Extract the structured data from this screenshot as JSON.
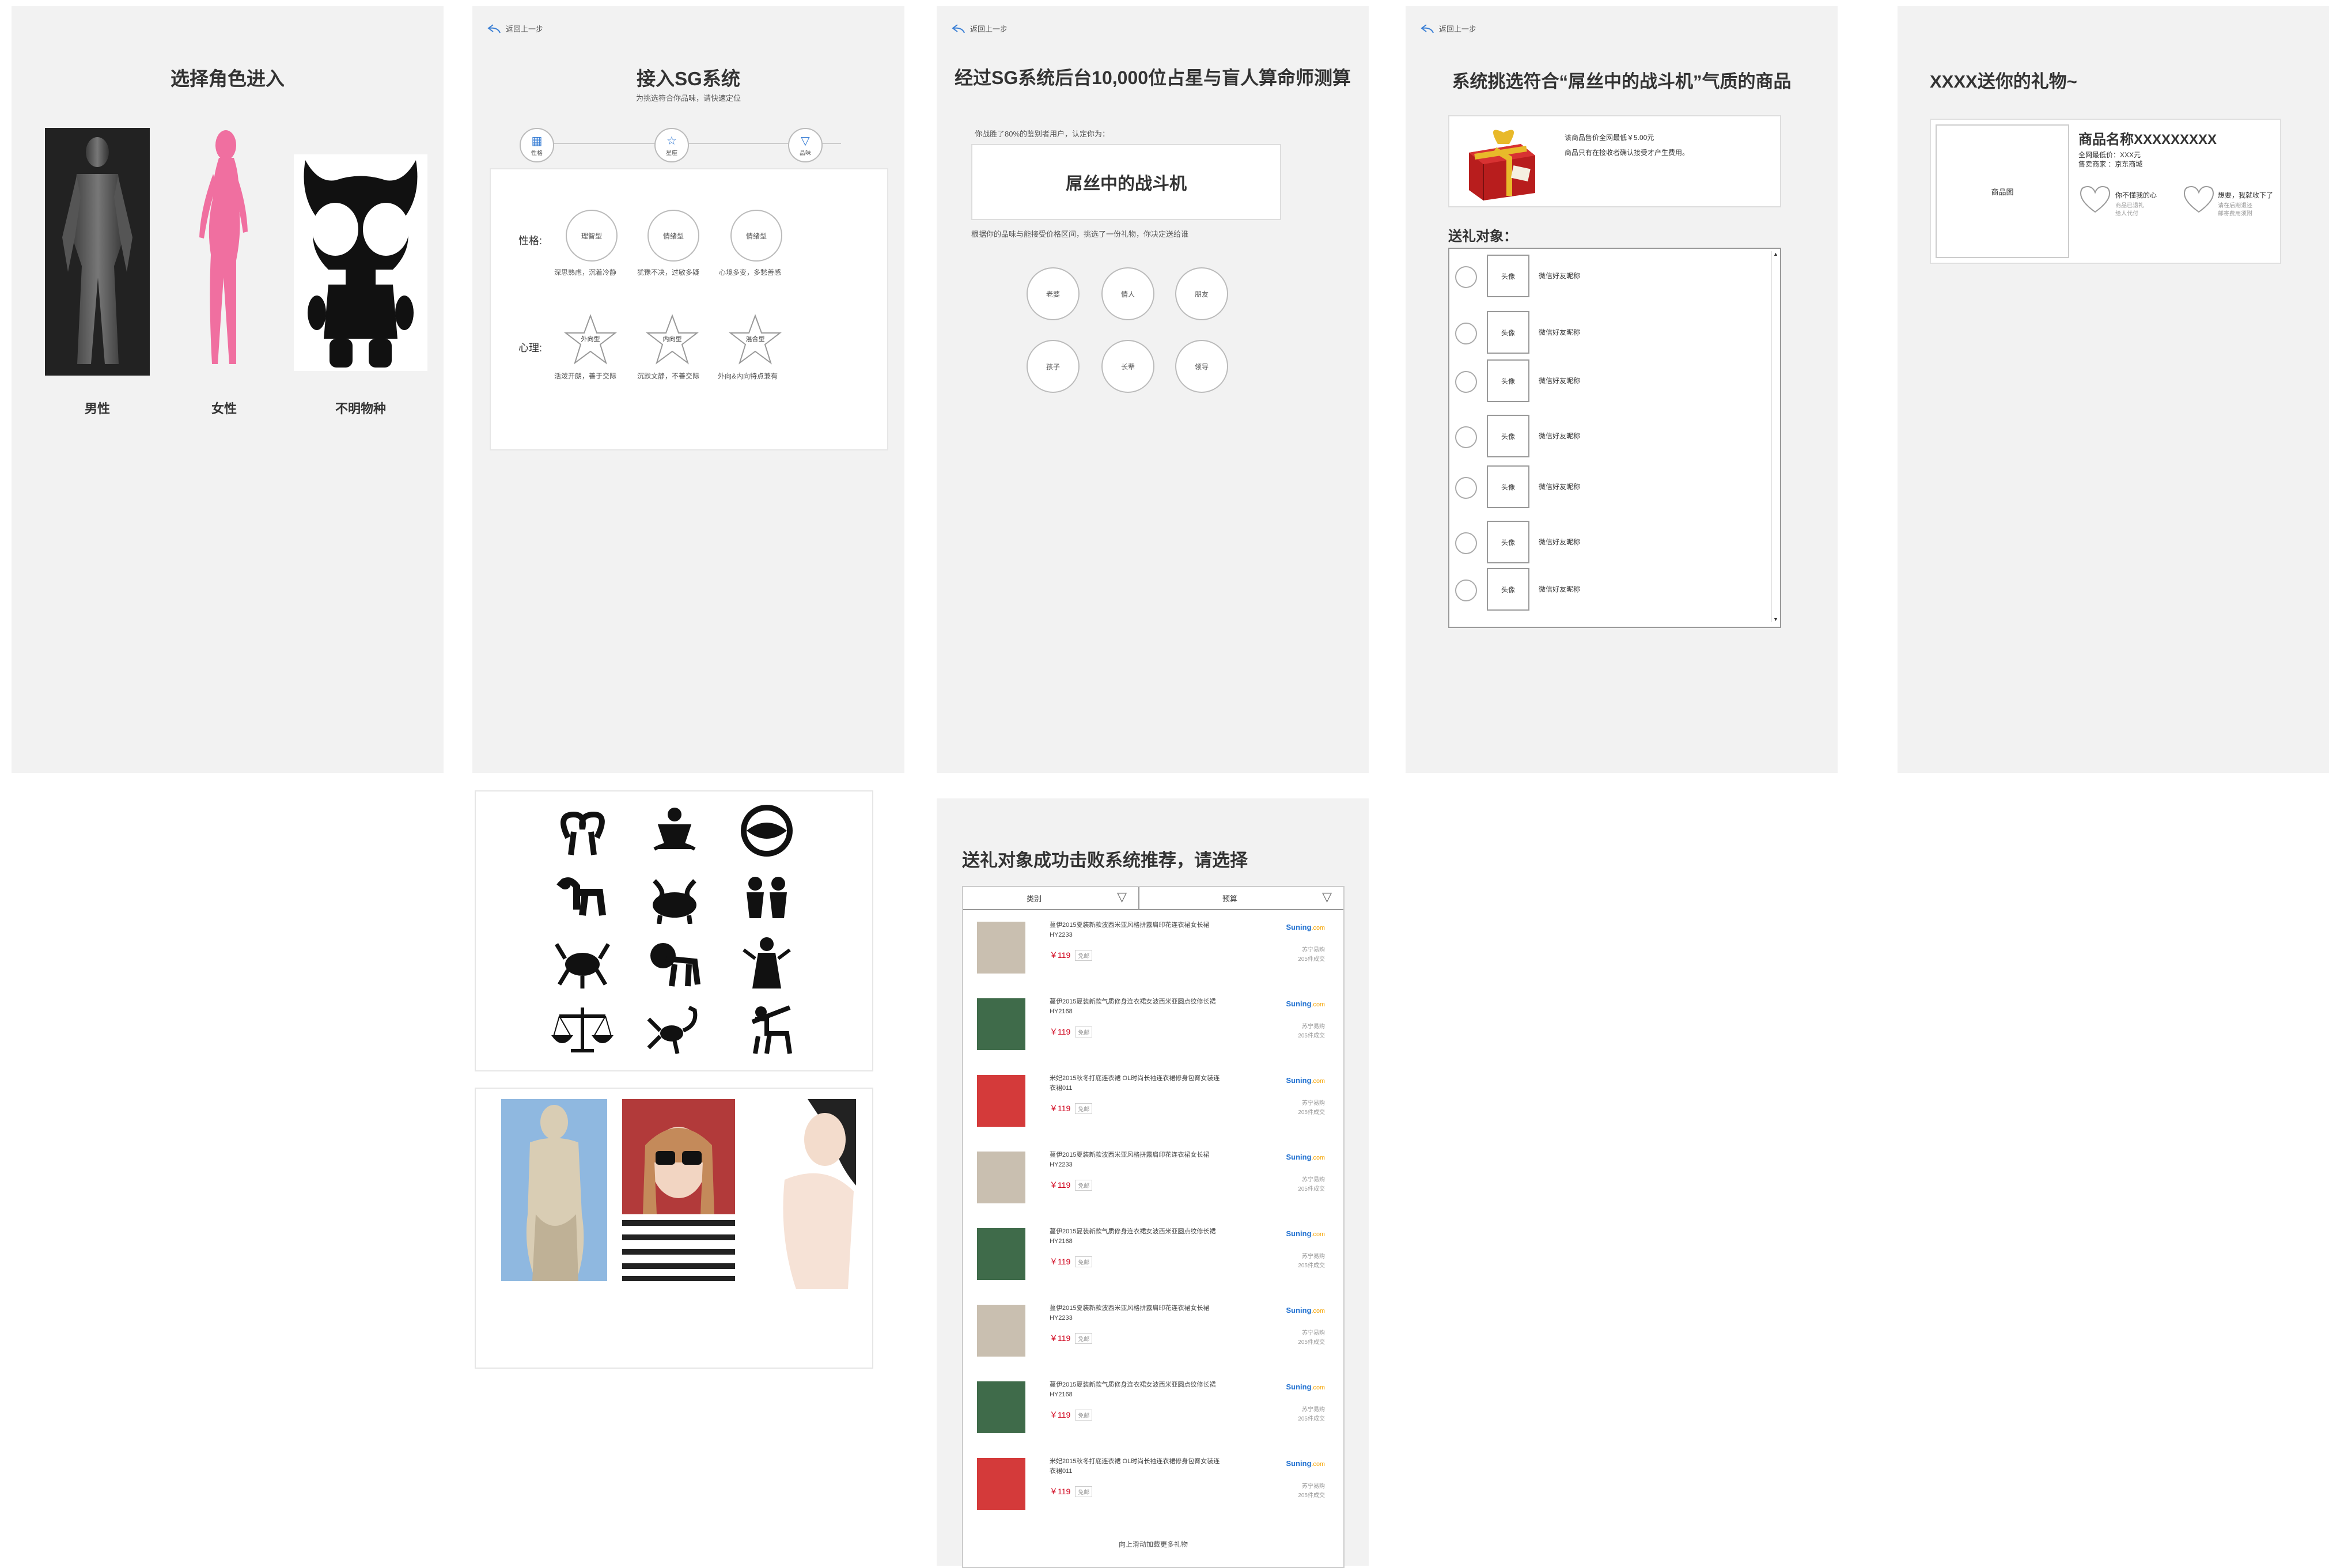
{
  "back_label": "返回上一步",
  "screen1": {
    "title": "选择角色进入",
    "roles": [
      {
        "label": "男性"
      },
      {
        "label": "女性"
      },
      {
        "label": "不明物种"
      }
    ]
  },
  "screen2": {
    "title": "接入SG系统",
    "subtitle": "为挑选符合你品味，请快速定位",
    "steps": [
      "性格",
      "星座",
      "品味"
    ],
    "personality_label": "性格:",
    "personality": [
      {
        "name": "理智型",
        "desc": "深思熟虑，沉着冷静"
      },
      {
        "name": "情绪型",
        "desc": "犹豫不决，过敏多疑"
      },
      {
        "name": "情绪型",
        "desc": "心境多变，多愁善感"
      }
    ],
    "psych_label": "心理:",
    "psych": [
      {
        "name": "外向型",
        "desc": "活泼开朗，善于交际"
      },
      {
        "name": "内向型",
        "desc": "沉默文静，不善交际"
      },
      {
        "name": "混合型",
        "desc": "外向&内向特点兼有"
      }
    ]
  },
  "screen3": {
    "title": "经过SG系统后台10,000位占星与盲人算命师测算",
    "intro": "你战胜了80%的鉴别者用户，认定你为：",
    "result": "屌丝中的战斗机",
    "hint": "根据你的品味与能接受价格区间，挑选了一份礼物，你决定送给谁",
    "targets": [
      "老婆",
      "情人",
      "朋友",
      "孩子",
      "长辈",
      "领导"
    ]
  },
  "screen4": {
    "title": "系统挑选符合“屌丝中的战斗机”气质的商品",
    "gift_desc1": "该商品售价全网最低￥5.00元",
    "gift_desc2": "商品只有在接收者确认接受才产生费用。",
    "recipients_label": "送礼对象：",
    "friends": [
      {
        "avatar": "头像",
        "name": "微信好友昵称"
      },
      {
        "avatar": "头像",
        "name": "微信好友昵称"
      },
      {
        "avatar": "头像",
        "name": "微信好友昵称"
      },
      {
        "avatar": "头像",
        "name": "微信好友昵称"
      },
      {
        "avatar": "头像",
        "name": "微信好友昵称"
      },
      {
        "avatar": "头像",
        "name": "微信好友昵称"
      },
      {
        "avatar": "头像",
        "name": "微信好友昵称"
      }
    ]
  },
  "screen5": {
    "title": "XXXX送你的礼物~",
    "product_img": "商品图",
    "product_name": "商品名称XXXXXXXXX",
    "price_line": "全网最低价：XXX元",
    "seller_line": "售卖商家  ：京东商城",
    "reject": "你不懂我的心",
    "reject_sub1": "商品已退礼",
    "reject_sub2": "给人代付",
    "accept": "想要，我就收下了",
    "accept_sub1": "请在后期退还",
    "accept_sub2": "邮寄费用须附"
  },
  "screen6": {
    "title": "送礼对象成功击败系统推荐，请选择",
    "filter_category": "类别",
    "filter_budget": "预算",
    "load_more": "向上滑动加载更多礼物",
    "products": [
      {
        "desc": "蔓伊2015夏装新款波西米亚风格拼露肩印花连衣裙女长裙HY2233",
        "price": "￥119",
        "free": "免邮",
        "store": "苏宁易购",
        "sold": "205件成交"
      },
      {
        "desc": "蔓伊2015夏装新款气质修身连衣裙女波西米亚圆点纹修长裙HY2168",
        "price": "￥119",
        "free": "免邮",
        "store": "苏宁易购",
        "sold": "205件成交"
      },
      {
        "desc": "米妃2015秋冬打底连衣裙 OL时尚长袖连衣裙修身包臀女装连衣裙011",
        "price": "￥119",
        "free": "免邮",
        "store": "苏宁易购",
        "sold": "205件成交"
      },
      {
        "desc": "蔓伊2015夏装新款波西米亚风格拼露肩印花连衣裙女长裙HY2233",
        "price": "￥119",
        "free": "免邮",
        "store": "苏宁易购",
        "sold": "205件成交"
      },
      {
        "desc": "蔓伊2015夏装新款气质修身连衣裙女波西米亚圆点纹修长裙HY2168",
        "price": "￥119",
        "free": "免邮",
        "store": "苏宁易购",
        "sold": "205件成交"
      },
      {
        "desc": "蔓伊2015夏装新款波西米亚风格拼露肩印花连衣裙女长裙HY2233",
        "price": "￥119",
        "free": "免邮",
        "store": "苏宁易购",
        "sold": "205件成交"
      },
      {
        "desc": "蔓伊2015夏装新款气质修身连衣裙女波西米亚圆点纹修长裙HY2168",
        "price": "￥119",
        "free": "免邮",
        "store": "苏宁易购",
        "sold": "205件成交"
      },
      {
        "desc": "米妃2015秋冬打底连衣裙 OL时尚长袖连衣裙修身包臀女装连衣裙011",
        "price": "￥119",
        "free": "免邮",
        "store": "苏宁易购",
        "sold": "205件成交"
      }
    ],
    "store_logo": "Suning",
    "store_logo_suffix": ".com"
  },
  "colors": {
    "panel": "#f2f2f2",
    "accent": "#1e6fd0",
    "price": "#d0021b",
    "pink": "#f06fa0"
  }
}
